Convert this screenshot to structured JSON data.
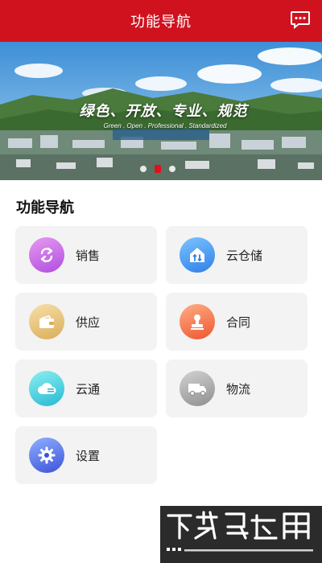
{
  "header": {
    "title": "功能导航",
    "message_icon": "chat-bubble-icon"
  },
  "banner": {
    "slogan_cn": "绿色、开放、专业、规范",
    "slogan_en": "Green . Open . Professional . Standardized",
    "dots": 3,
    "active_dot": 2
  },
  "section": {
    "title": "功能导航"
  },
  "cards": [
    {
      "label": "销售",
      "icon": "exchange-icon"
    },
    {
      "label": "云仓储",
      "icon": "warehouse-icon"
    },
    {
      "label": "供应",
      "icon": "wallet-icon"
    },
    {
      "label": "合同",
      "icon": "stamp-icon"
    },
    {
      "label": "云通",
      "icon": "cloud-icon"
    },
    {
      "label": "物流",
      "icon": "truck-icon"
    },
    {
      "label": "设置",
      "icon": "gear-icon"
    }
  ],
  "watermark": {
    "title": "下载鸟应用",
    "url": "www.xiazainiao.com"
  },
  "colors": {
    "brand_red": "#d0121f"
  }
}
